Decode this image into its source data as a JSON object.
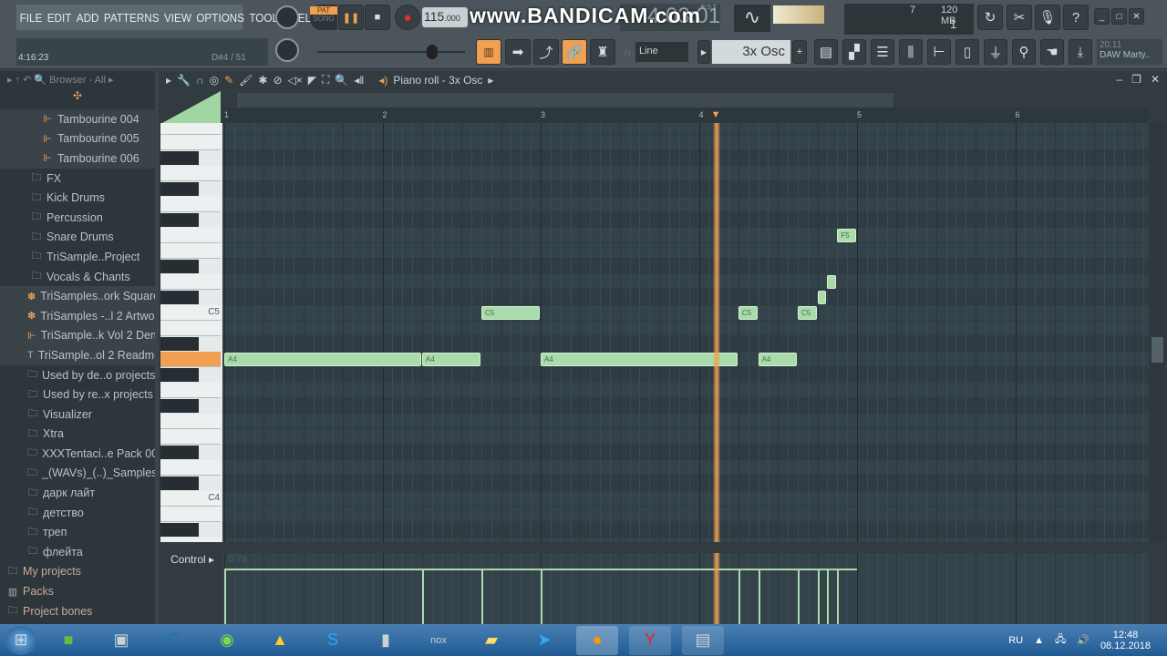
{
  "menu": [
    "FILE",
    "EDIT",
    "ADD",
    "PATTERNS",
    "VIEW",
    "OPTIONS",
    "TOOLS",
    "HELP"
  ],
  "hint": {
    "time": "4:16:23",
    "note": "D#4 / 51"
  },
  "transport": {
    "pat": "PAT",
    "song": "SONG",
    "tempo": "115",
    "tempo_dec": ".000",
    "time": "4:03:01",
    "time_label": "B:S:T"
  },
  "watermark": "www.BANDICAM.com",
  "monitor": {
    "voices": "7",
    "memory": "120 MB",
    "cpu": "1"
  },
  "toolbar": {
    "snap": "Line",
    "channel": "3x Osc",
    "news_date": "20.11",
    "news_title": "DAW Marty.."
  },
  "browser": {
    "title": "Browser - All",
    "items": [
      {
        "label": "Tambourine 004",
        "icon": "sample",
        "hl": true
      },
      {
        "label": "Tambourine 005",
        "icon": "sample",
        "hl": true
      },
      {
        "label": "Tambourine 006",
        "icon": "sample",
        "hl": true
      },
      {
        "label": "FX",
        "icon": "folder",
        "ind": 1
      },
      {
        "label": "Kick Drums",
        "icon": "folder",
        "ind": 1
      },
      {
        "label": "Percussion",
        "icon": "folder",
        "ind": 1
      },
      {
        "label": "Snare Drums",
        "icon": "folder",
        "ind": 1
      },
      {
        "label": "TriSample..Project",
        "icon": "folder",
        "ind": 1
      },
      {
        "label": "Vocals & Chants",
        "icon": "folder",
        "ind": 1
      },
      {
        "label": "TriSamples..ork Square",
        "icon": "plugin",
        "hl": true
      },
      {
        "label": "TriSamples -..l 2 Artwork",
        "icon": "plugin",
        "hl": true
      },
      {
        "label": "TriSample..k Vol 2 Demo",
        "icon": "sample",
        "hl": true
      },
      {
        "label": "TriSample..ol 2 Readme",
        "icon": "text",
        "hl": true
      },
      {
        "label": "Used by de..o projects",
        "icon": "folder"
      },
      {
        "label": "Used by re..x projects",
        "icon": "folder"
      },
      {
        "label": "Visualizer",
        "icon": "folder"
      },
      {
        "label": "Xtra",
        "icon": "folder"
      },
      {
        "label": "XXXTentaci..e Pack 001",
        "icon": "folder"
      },
      {
        "label": "_(WAVs)_(..)_Samples",
        "icon": "folder"
      },
      {
        "label": "дарк лайт",
        "icon": "folder"
      },
      {
        "label": "детство",
        "icon": "folder"
      },
      {
        "label": "треп",
        "icon": "folder"
      },
      {
        "label": "флейта",
        "icon": "folder"
      },
      {
        "label": "My projects",
        "icon": "folder",
        "top": 1
      },
      {
        "label": "Packs",
        "icon": "packs",
        "top": 1
      },
      {
        "label": "Project bones",
        "icon": "folder",
        "top": 1
      },
      {
        "label": "Recorded",
        "icon": "folder",
        "top": 1
      }
    ]
  },
  "pianoroll": {
    "title": "Piano roll - 3x Osc",
    "ruler": [
      "1",
      "2",
      "3",
      "4",
      "5",
      "6"
    ],
    "key_labels": {
      "C5": "C5",
      "C4": "C4"
    },
    "control": "Control",
    "velocity": 0.78,
    "playhead_bar": 4.11,
    "highlighted_key": "A4",
    "notes": [
      {
        "pitch": "A4",
        "start": 1.0,
        "length": 1.25,
        "label": "A4"
      },
      {
        "pitch": "A4",
        "start": 2.25,
        "length": 0.375,
        "label": "A4"
      },
      {
        "pitch": "C5",
        "start": 2.625,
        "length": 0.375,
        "label": "C5"
      },
      {
        "pitch": "A4",
        "start": 3.0,
        "length": 1.25,
        "label": "A4"
      },
      {
        "pitch": "C5",
        "start": 4.25,
        "length": 0.125,
        "label": "C5"
      },
      {
        "pitch": "A4",
        "start": 4.375,
        "length": 0.25,
        "label": "A4"
      },
      {
        "pitch": "C5",
        "start": 4.625,
        "length": 0.125,
        "label": "C5"
      },
      {
        "pitch": "C#5",
        "start": 4.75,
        "length": 0.0625,
        "label": ""
      },
      {
        "pitch": "D5",
        "start": 4.8125,
        "length": 0.0625,
        "label": ""
      },
      {
        "pitch": "F5",
        "start": 4.875,
        "length": 0.125,
        "label": "F5"
      }
    ]
  },
  "taskbar": {
    "lang": "RU",
    "time": "12:48",
    "date": "08.12.2018"
  },
  "colors": {
    "note": "#a9dcaa",
    "playhead": "#f0a050",
    "accent": "#f0a050"
  }
}
